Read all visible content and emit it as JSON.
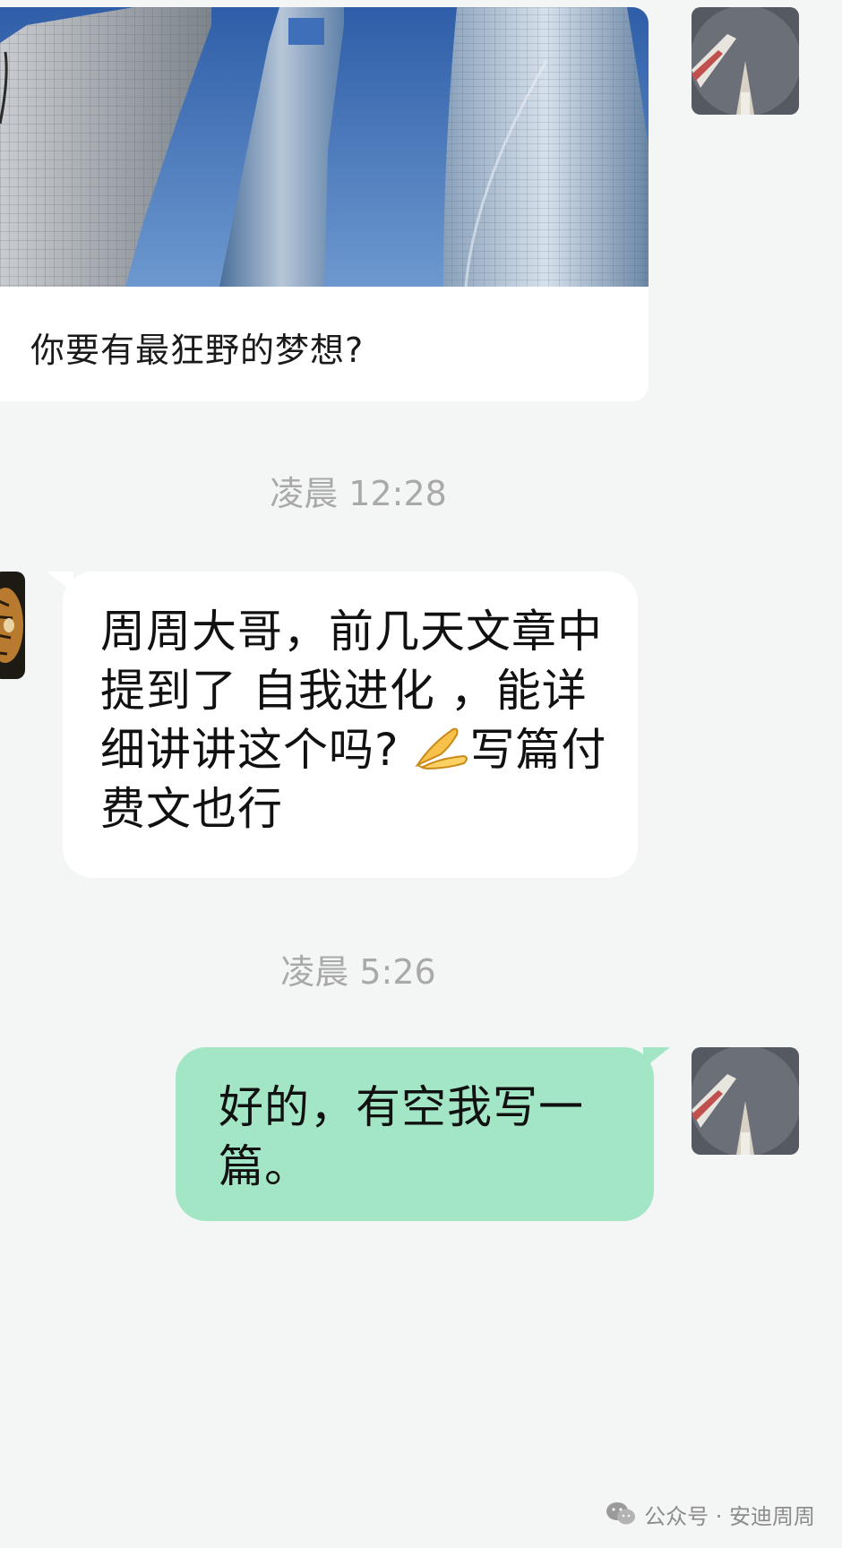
{
  "shared_card": {
    "caption": "你要有最狂野的梦想?"
  },
  "messages": [
    {
      "timestamp": "凌晨 12:28",
      "direction": "incoming",
      "text_before_emoji": "周周大哥，前几天文章中提到了 自我进化 ，能详细讲讲这个吗? ",
      "emoji": "praying-hands-icon",
      "text_after_emoji": "写篇付费文也行"
    },
    {
      "timestamp": "凌晨 5:26",
      "direction": "outgoing",
      "text": "好的，有空我写一篇。"
    }
  ],
  "watermark": {
    "text": "公众号 · 安迪周周",
    "icon": "wechat-icon"
  },
  "colors": {
    "background": "#f4f5f5",
    "incoming_bubble": "#ffffff",
    "outgoing_bubble": "#a3e6c6",
    "timestamp_text": "#a9a9a9",
    "sky": "#3f6fb8"
  }
}
